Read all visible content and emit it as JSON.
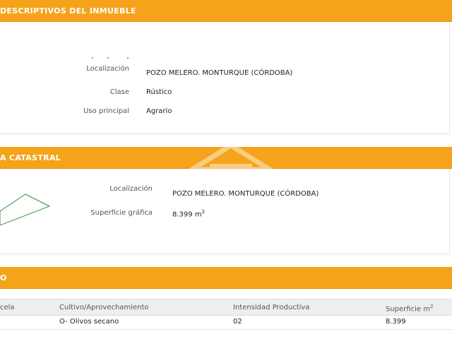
{
  "sections": {
    "descriptive": {
      "title": "DESCRIPTIVOS DEL INMUEBLE"
    },
    "catastral": {
      "title": "A CATASTRAL"
    },
    "cultivo": {
      "title": "O"
    }
  },
  "inmueble": {
    "localizacion_label": "Localización",
    "localizacion_value": "POZO MELERO. MONTURQUE (CÓRDOBA)",
    "clase_label": "Clase",
    "clase_value": "Rústico",
    "uso_label": "Uso principal",
    "uso_value": "Agrario"
  },
  "parcela": {
    "localizacion_label": "Localización",
    "localizacion_value": "POZO MELERO. MONTURQUE (CÓRDOBA)",
    "superficie_label": "Superficie gráfica",
    "superficie_value": "8.399 m",
    "superficie_unit_sup": "2"
  },
  "cultivos": {
    "headers": {
      "subparcela": "cela",
      "cultivo": "Cultivo/Aprovechamiento",
      "intensidad": "Intensidad Productiva",
      "superficie": "Superficie m",
      "superficie_sup": "2"
    },
    "rows": [
      {
        "cultivo": "O- Olivos secano",
        "intensidad": "02",
        "superficie": "8.399"
      }
    ]
  },
  "colors": {
    "header_band": "#f5a31a",
    "header_text": "#ffffff",
    "parcel_outline": "#3a8a3a"
  }
}
